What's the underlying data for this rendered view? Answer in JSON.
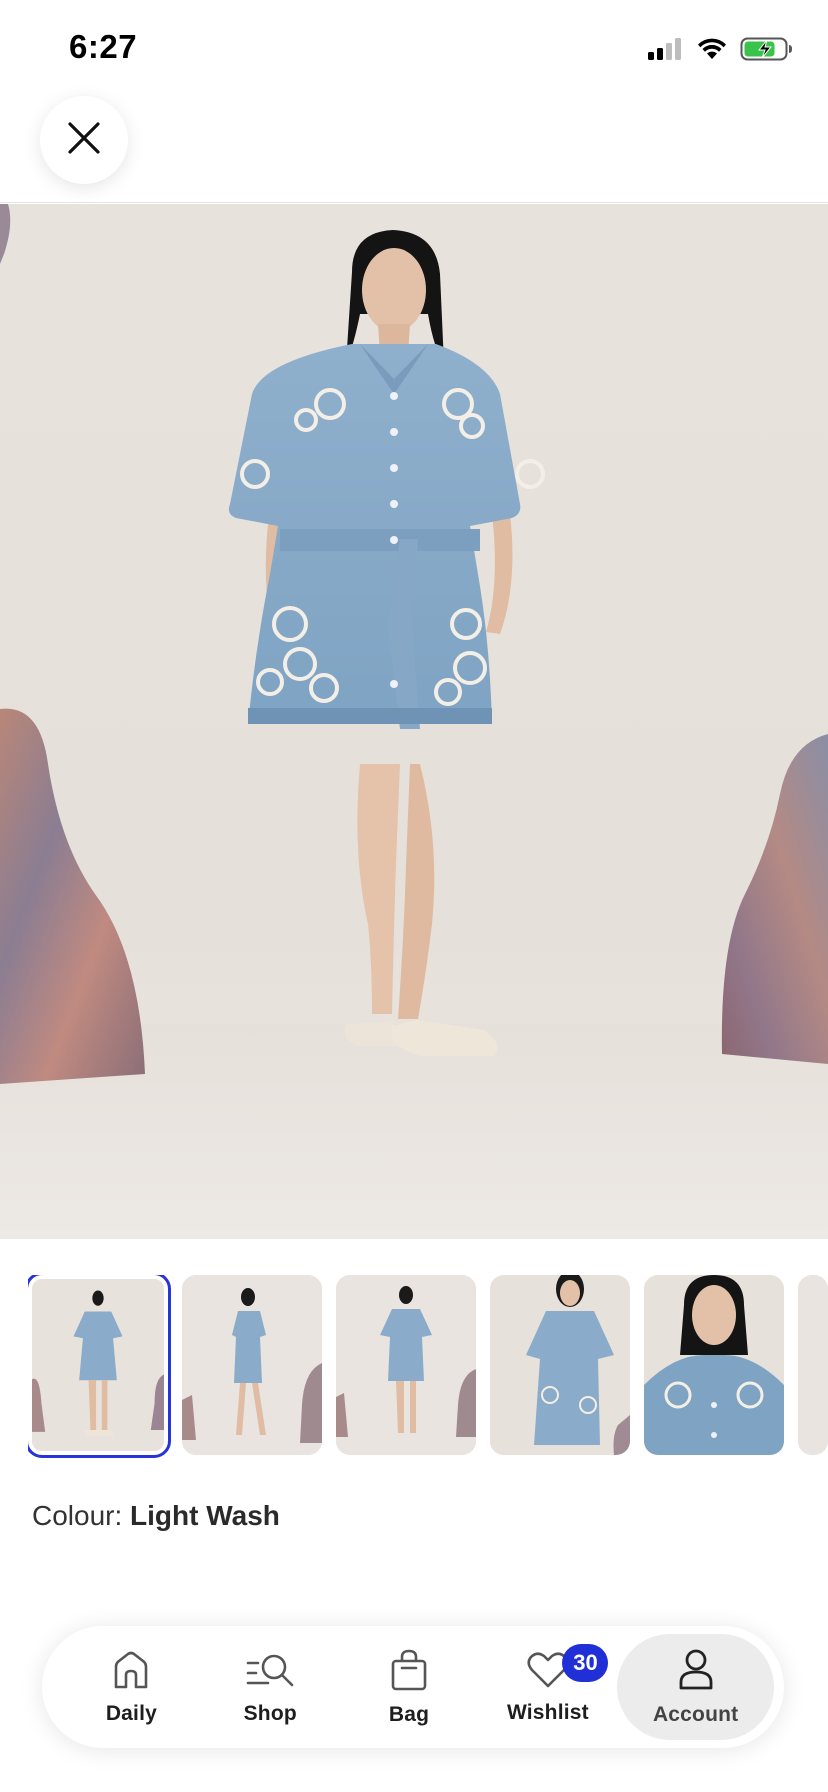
{
  "status": {
    "time": "6:27"
  },
  "thumbnails": [
    {
      "view": "front-full",
      "selected": true
    },
    {
      "view": "side-full",
      "selected": false
    },
    {
      "view": "back-full",
      "selected": false
    },
    {
      "view": "front-crop",
      "selected": false
    },
    {
      "view": "detail-crop",
      "selected": false
    }
  ],
  "product": {
    "colour_label": "Colour:",
    "colour_value": "Light Wash"
  },
  "nav": {
    "items": [
      {
        "label": "Daily",
        "icon": "home-icon"
      },
      {
        "label": "Shop",
        "icon": "search-list-icon"
      },
      {
        "label": "Bag",
        "icon": "bag-icon"
      },
      {
        "label": "Wishlist",
        "icon": "heart-icon",
        "badge": "30"
      },
      {
        "label": "Account",
        "icon": "account-icon",
        "active": true
      }
    ]
  },
  "colors": {
    "accent": "#2030d6",
    "selected_outline": "#2634d8",
    "battery_green": "#3ac34a"
  }
}
